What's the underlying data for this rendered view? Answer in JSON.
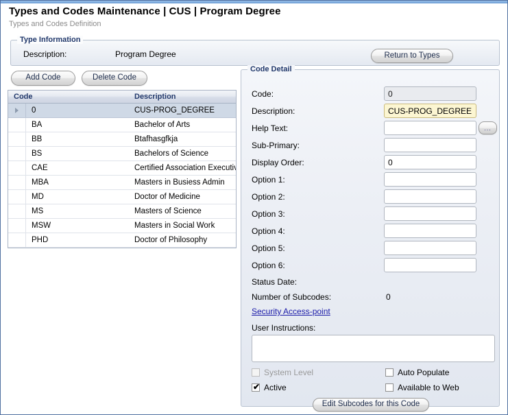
{
  "header": {
    "title": "Types and Codes Maintenance  |  CUS | Program Degree",
    "subtitle": "Types and Codes Definition"
  },
  "type_information": {
    "legend": "Type Information",
    "description_label": "Description:",
    "description_value": "Program Degree",
    "return_button": "Return to Types"
  },
  "toolbar": {
    "add_code": "Add Code",
    "delete_code": "Delete Code"
  },
  "codes_table": {
    "columns": [
      "Code",
      "Description"
    ],
    "rows": [
      {
        "code": "0",
        "description": "CUS-PROG_DEGREE",
        "selected": true
      },
      {
        "code": "BA",
        "description": "Bachelor of Arts",
        "selected": false
      },
      {
        "code": "BB",
        "description": "Btafhasgfkja",
        "selected": false
      },
      {
        "code": "BS",
        "description": "Bachelors of Science",
        "selected": false
      },
      {
        "code": "CAE",
        "description": "Certified Association Executive",
        "selected": false
      },
      {
        "code": "MBA",
        "description": "Masters in Busiess Admin",
        "selected": false
      },
      {
        "code": "MD",
        "description": "Doctor of Medicine",
        "selected": false
      },
      {
        "code": "MS",
        "description": "Masters of Science",
        "selected": false
      },
      {
        "code": "MSW",
        "description": "Masters in Social Work",
        "selected": false
      },
      {
        "code": "PHD",
        "description": "Doctor of Philosophy",
        "selected": false
      }
    ]
  },
  "code_detail": {
    "legend": "Code Detail",
    "fields": {
      "code_label": "Code:",
      "code_value": "0",
      "description_label": "Description:",
      "description_value": "CUS-PROG_DEGREE",
      "help_text_label": "Help Text:",
      "help_text_value": "",
      "help_text_browse": "...",
      "sub_primary_label": "Sub-Primary:",
      "sub_primary_value": "",
      "display_order_label": "Display Order:",
      "display_order_value": "0",
      "option1_label": "Option 1:",
      "option1_value": "",
      "option2_label": "Option 2:",
      "option2_value": "",
      "option3_label": "Option 3:",
      "option3_value": "",
      "option4_label": "Option 4:",
      "option4_value": "",
      "option5_label": "Option 5:",
      "option5_value": "",
      "option6_label": "Option 6:",
      "option6_value": "",
      "status_date_label": "Status Date:",
      "status_date_value": "",
      "number_of_subcodes_label": "Number of Subcodes:",
      "number_of_subcodes_value": "0",
      "security_access_point_link": "Security Access-point",
      "user_instructions_label": "User Instructions:",
      "user_instructions_value": ""
    },
    "checkboxes": [
      {
        "label": "System Level",
        "checked": false,
        "disabled": true
      },
      {
        "label": "Auto Populate",
        "checked": false,
        "disabled": false
      },
      {
        "label": "Active",
        "checked": true,
        "disabled": false
      },
      {
        "label": "Available to Web",
        "checked": false,
        "disabled": false
      }
    ],
    "edit_subcodes_button": "Edit Subcodes for this Code"
  },
  "colors": {
    "accent_blue": "#7fabdd",
    "legend_text": "#21386b",
    "highlight_field": "#fcf6d2",
    "selected_row": "#cfd9e6",
    "link": "#1a1aa8"
  }
}
